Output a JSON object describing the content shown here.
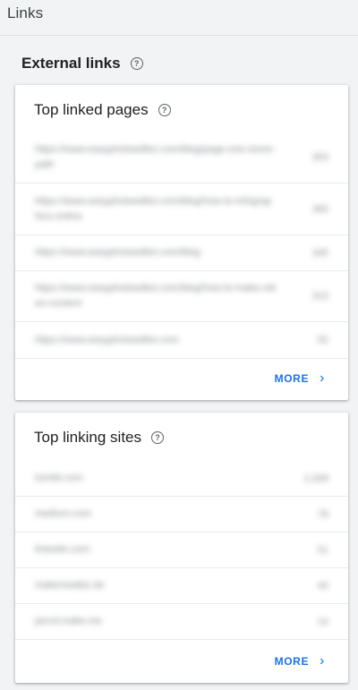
{
  "page": {
    "title": "Links"
  },
  "external_links": {
    "heading": "External links",
    "top_linked_pages": {
      "title": "Top linked pages",
      "rows": [
        {
          "url": "https://www.easyphotoeditor.com/blog/page-one-some-path",
          "count": "353"
        },
        {
          "url": "https://www.easyphotoeditor.com/blog/how-to-infographics-online",
          "count": "360"
        },
        {
          "url": "https://www.easyphotoeditor.com/blog",
          "count": "345"
        },
        {
          "url": "https://www.easyphotoeditor.com/blog/how-to-make-video-content",
          "count": "313"
        },
        {
          "url": "https://www.easyphotoeditor.com",
          "count": "92"
        }
      ],
      "more_label": "MORE"
    },
    "top_linking_sites": {
      "title": "Top linking sites",
      "rows": [
        {
          "url": "tumblr.com",
          "count": "2,309"
        },
        {
          "url": "medium.com",
          "count": "78"
        },
        {
          "url": "linkedin.com",
          "count": "51"
        },
        {
          "url": "makemeabiz.de",
          "count": "40"
        },
        {
          "url": "jancd.make.me",
          "count": "14"
        }
      ],
      "more_label": "MORE"
    }
  }
}
